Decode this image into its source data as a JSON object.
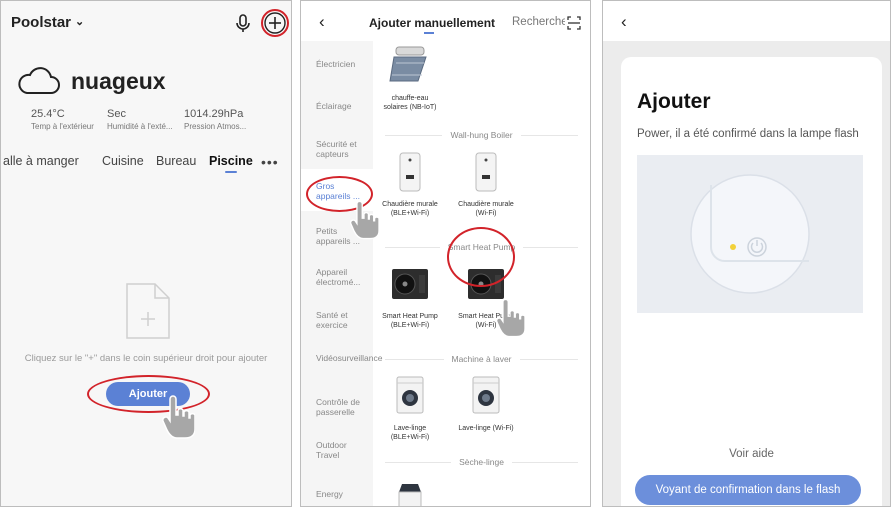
{
  "panel1": {
    "home_name": "Poolstar",
    "weather": {
      "condition": "nuageux",
      "stats": [
        {
          "value": "25.4°C",
          "label": "Temp à l'extérieur"
        },
        {
          "value": "Sec",
          "label": "Humidité à l'exté..."
        },
        {
          "value": "1014.29hPa",
          "label": "Pression Atmos..."
        }
      ]
    },
    "rooms": [
      "alle à manger",
      "Cuisine",
      "Bureau",
      "Piscine"
    ],
    "active_room": "Piscine",
    "empty_text": "Cliquez sur le \"+\" dans le coin supérieur droit pour ajouter",
    "add_button": "Ajouter"
  },
  "panel2": {
    "title": "Ajouter manuellement",
    "search_tab": "Recherche",
    "categories": [
      "Électricien",
      "Éclairage",
      "Sécurité et capteurs",
      "Gros appareils ...",
      "Petits appareils ...",
      "Appareil électromé...",
      "Santé et exercice",
      "Vidéosurveillance",
      "Contrôle de passerelle",
      "Outdoor Travel",
      "Energy"
    ],
    "active_category": "Gros appareils ...",
    "devices_top": {
      "name": "chauffe-eau solaires (NB-IoT)"
    },
    "sections": [
      {
        "title": "Wall-hung Boiler",
        "devices": [
          "Chaudière murale (BLE+Wi-Fi)",
          "Chaudière murale (Wi-Fi)"
        ]
      },
      {
        "title": "Smart Heat Pump",
        "devices": [
          "Smart Heat Pump (BLE+Wi-Fi)",
          "Smart Heat Pump (Wi-Fi)"
        ]
      },
      {
        "title": "Machine à laver",
        "devices": [
          "Lave-linge (BLE+Wi-Fi)",
          "Lave-linge (Wi-Fi)"
        ]
      },
      {
        "title": "Sèche-linge",
        "devices": []
      }
    ]
  },
  "panel3": {
    "title": "Ajouter",
    "subtitle": "Power, il a été confirmé dans la lampe flash",
    "help_link": "Voir aide",
    "confirm_button": "Voyant de confirmation dans le flash"
  },
  "colors": {
    "accent": "#5b81d5",
    "annotation": "#d2232a",
    "power_led": "#f2d13a"
  }
}
